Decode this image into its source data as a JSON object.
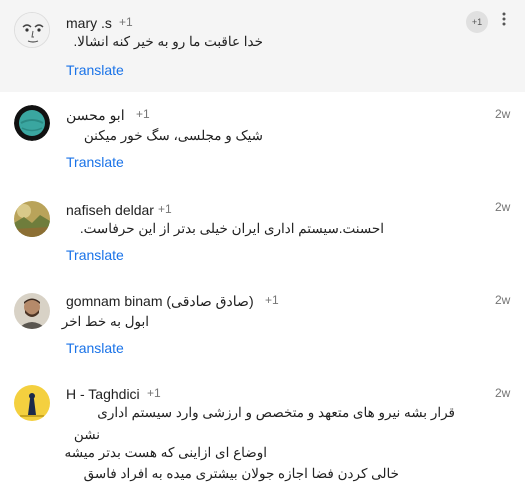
{
  "comments": [
    {
      "author": "mary .s",
      "plus": "+1",
      "time": "",
      "lines": [
        "خدا عاقبت ما رو به خیر کنه انشالا."
      ],
      "translate": "Translate",
      "menu_plus": "+1",
      "menu_icon": "more-vert-icon",
      "avatar": "sketch-face-avatar"
    },
    {
      "author": "ابو محسن",
      "plus": "+1",
      "time": "2w",
      "lines": [
        "شیک و مجلسی، سگ خور میکنن"
      ],
      "translate": "Translate",
      "avatar": "teal-globe-avatar"
    },
    {
      "author": "nafiseh deldar",
      "plus": "+1",
      "time": "2w",
      "lines": [
        "احسنت.سیستم اداری ایران خیلی بدتر از این حرفاست."
      ],
      "translate": "Translate",
      "avatar": "landscape-avatar"
    },
    {
      "author": "gomnam binam (صادق صادقی)",
      "plus": "+1",
      "time": "2w",
      "lines": [
        "ابول به خط اخر"
      ],
      "translate": "Translate",
      "avatar": "man-photo-avatar"
    },
    {
      "author": "H - Taghdici",
      "plus": "+1",
      "time": "2w",
      "lines": [
        "قرار بشه  نیرو های متعهد و متخصص و ارزشی  وارد سیستم  اداری",
        "نشن",
        "اوضاع ای ازاینی که هست بدتر میشه",
        "خالی کردن فضا  اجازه جولان بیشتری میده به  افراد فاسق"
      ],
      "translate": "",
      "avatar": "yellow-figure-avatar"
    }
  ]
}
